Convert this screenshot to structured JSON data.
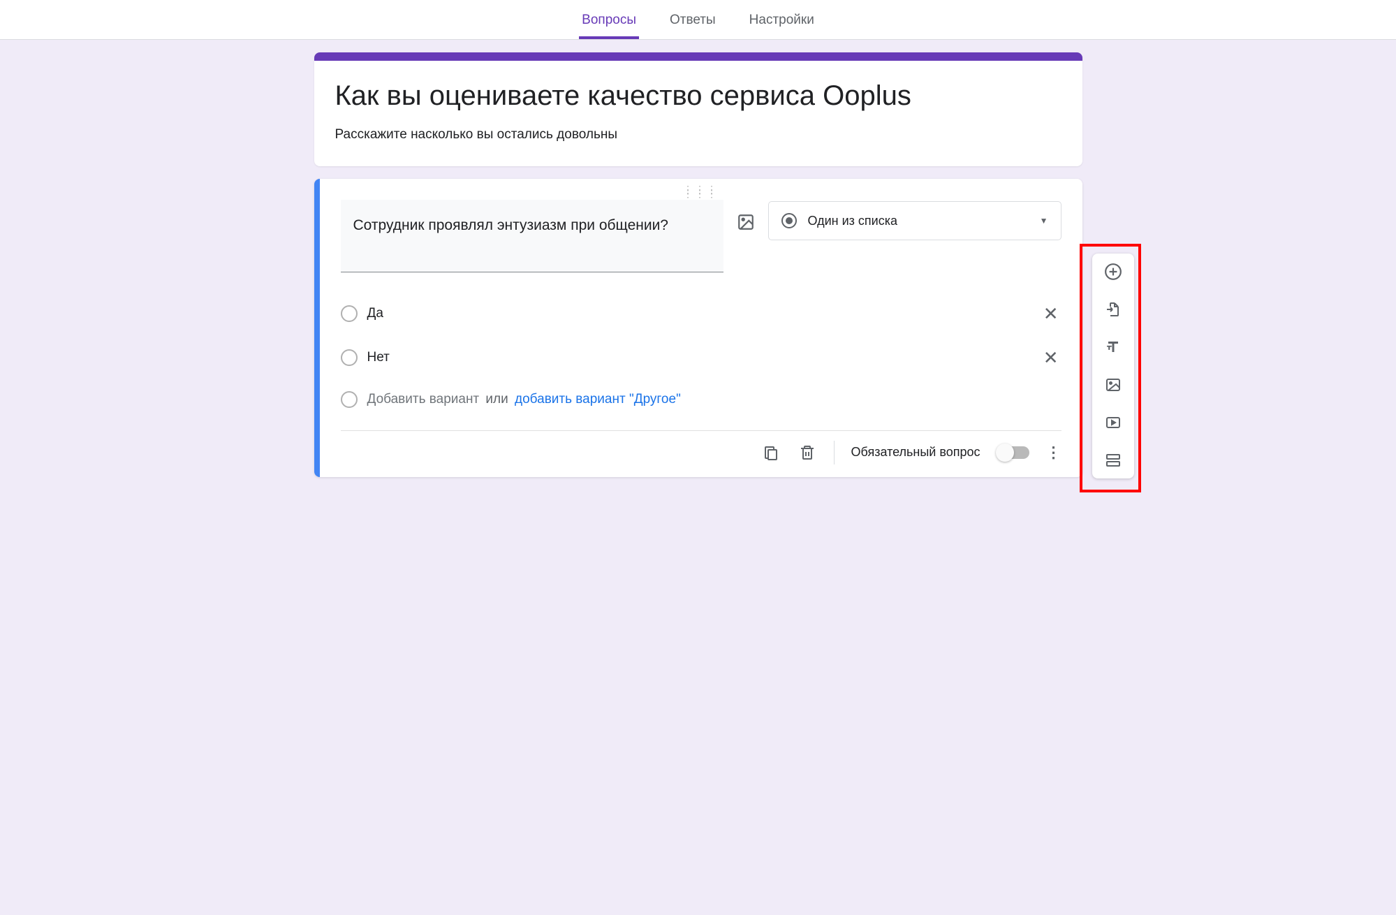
{
  "tabs": {
    "questions": "Вопросы",
    "answers": "Ответы",
    "settings": "Настройки",
    "active": "questions"
  },
  "form": {
    "title": "Как вы оцениваете качество сервиса Ooplus",
    "description": "Расскажите насколько вы остались довольны"
  },
  "question": {
    "text": "Сотрудник проявлял энтузиазм при общении?",
    "type_label": "Один из списка",
    "options": [
      {
        "text": "Да"
      },
      {
        "text": "Нет"
      }
    ],
    "add_option_placeholder": "Добавить вариант",
    "add_separator": "или",
    "add_other_link": "добавить вариант \"Другое\""
  },
  "footer": {
    "required_label": "Обязательный вопрос",
    "required_on": false
  }
}
